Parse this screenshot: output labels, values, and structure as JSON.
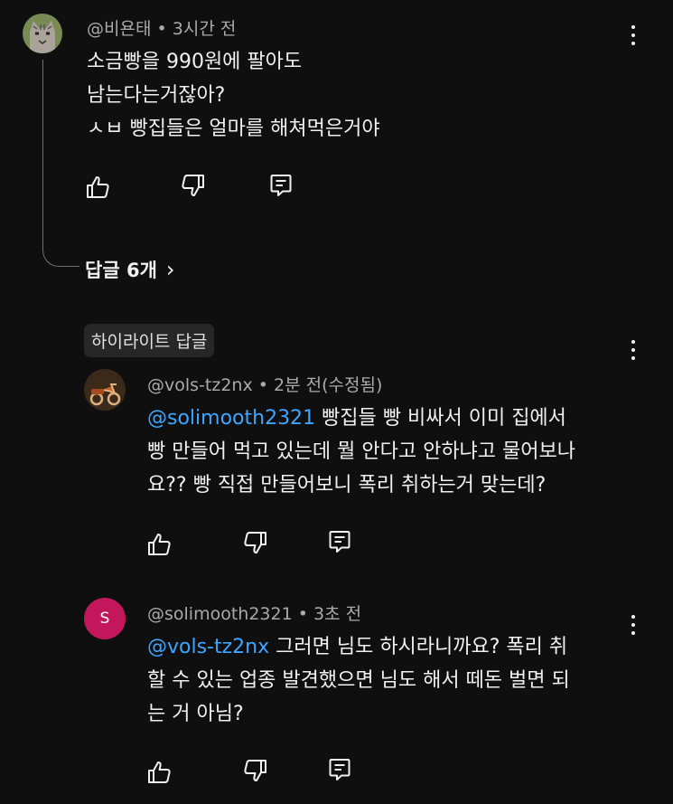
{
  "comment": {
    "author": "@비욘태",
    "time": "3시간 전",
    "lines": [
      "소금빵을 990원에 팔아도",
      "남는다는거잖아?",
      "ㅅㅂ 빵집들은 얼마를 해쳐먹은거야"
    ],
    "replies_label": "답글 6개",
    "replies_chevron": "›"
  },
  "highlight_label": "하이라이트 답글",
  "replies": [
    {
      "author": "@vols-tz2nx",
      "time": "2분 전(수정됨)",
      "mention": "@solimooth2321",
      "lines": [
        " 빵집들 빵 비싸서 이미 집에서",
        "빵 만들어 먹고 있는데 뭘 안다고 안하냐고 물어보나",
        "요?? 빵 직접 만들어보니 폭리 취하는거 맞는데?"
      ]
    },
    {
      "author": "@solimooth2321",
      "time": "3초 전",
      "avatar_letter": "S",
      "mention": "@vols-tz2nx",
      "lines": [
        " 그러면 님도 하시라니까요? 폭리 취",
        "할 수 있는 업종 발견했으면 님도 해서 떼돈 벌면 되",
        "는 거 아님?"
      ]
    }
  ],
  "icons": {
    "like": "thumbs-up-icon",
    "dislike": "thumbs-down-icon",
    "reply": "comment-icon",
    "more": "more-vert-icon"
  },
  "colors": {
    "background": "#0f0f0f",
    "text": "#f1f1f1",
    "meta": "#aaaaaa",
    "mention": "#3ea6ff",
    "letter_avatar": "#c2185b"
  }
}
